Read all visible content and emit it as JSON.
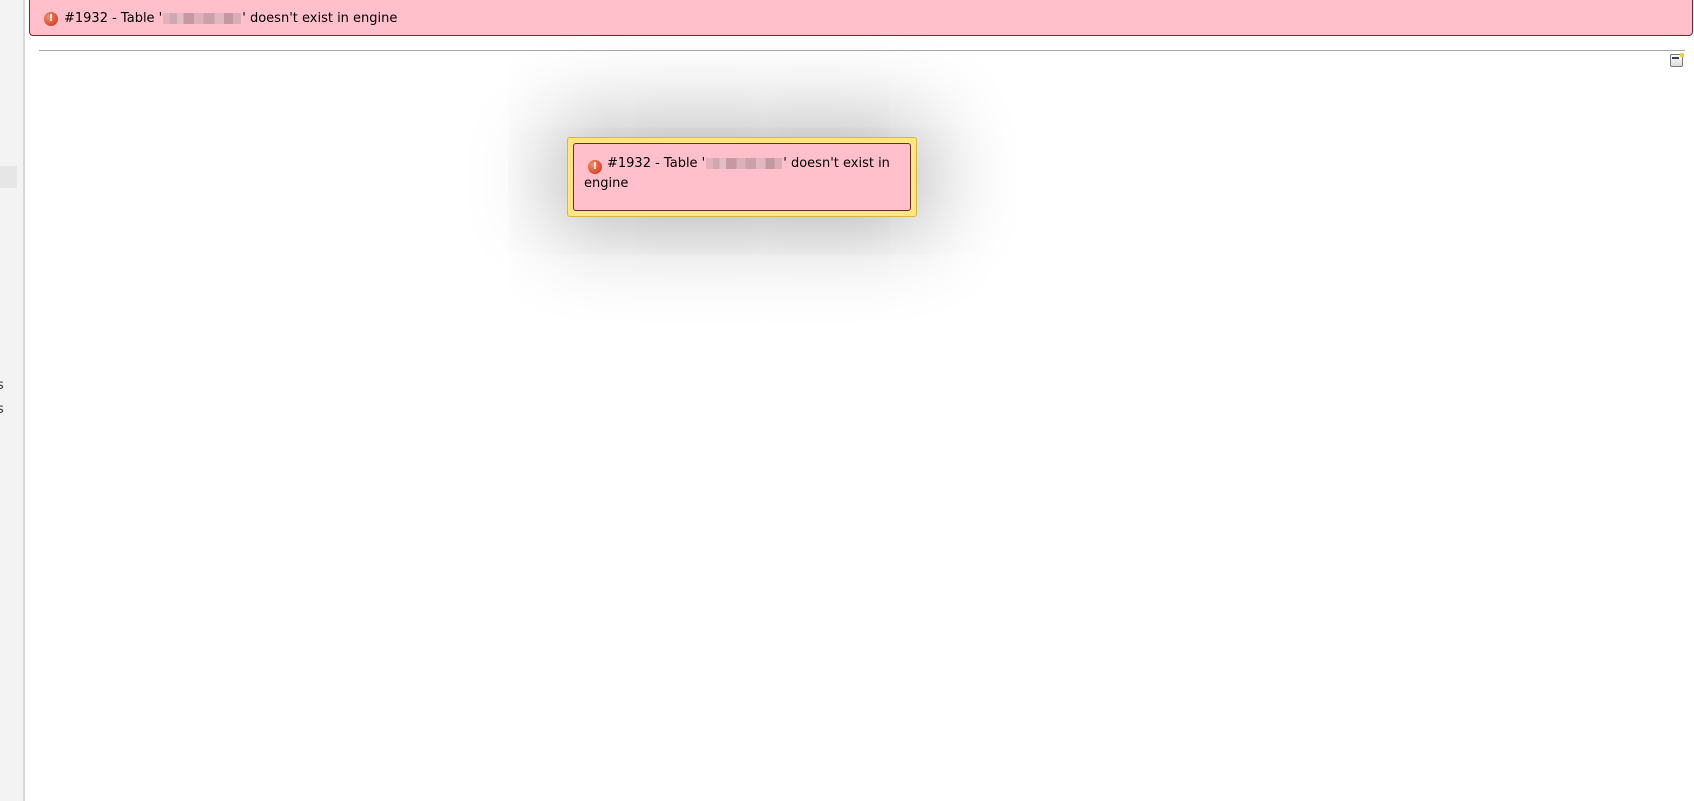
{
  "sidebar": {
    "fragments": [
      "s",
      "s"
    ]
  },
  "top_error": {
    "icon": "error-icon",
    "prefix": "#1932 - Table '",
    "suffix": "' doesn't exist in engine",
    "icon_glyph": "!"
  },
  "dialog": {
    "icon": "error-icon",
    "icon_glyph": "!",
    "prefix": "#1932 - Table '",
    "suffix": "' doesn't exist in engine"
  },
  "colors": {
    "error_background": "#ffc0cb",
    "dialog_frame": "#ffe680",
    "error_icon": "#d9452a"
  },
  "corner_icon": "window-toggle-icon"
}
